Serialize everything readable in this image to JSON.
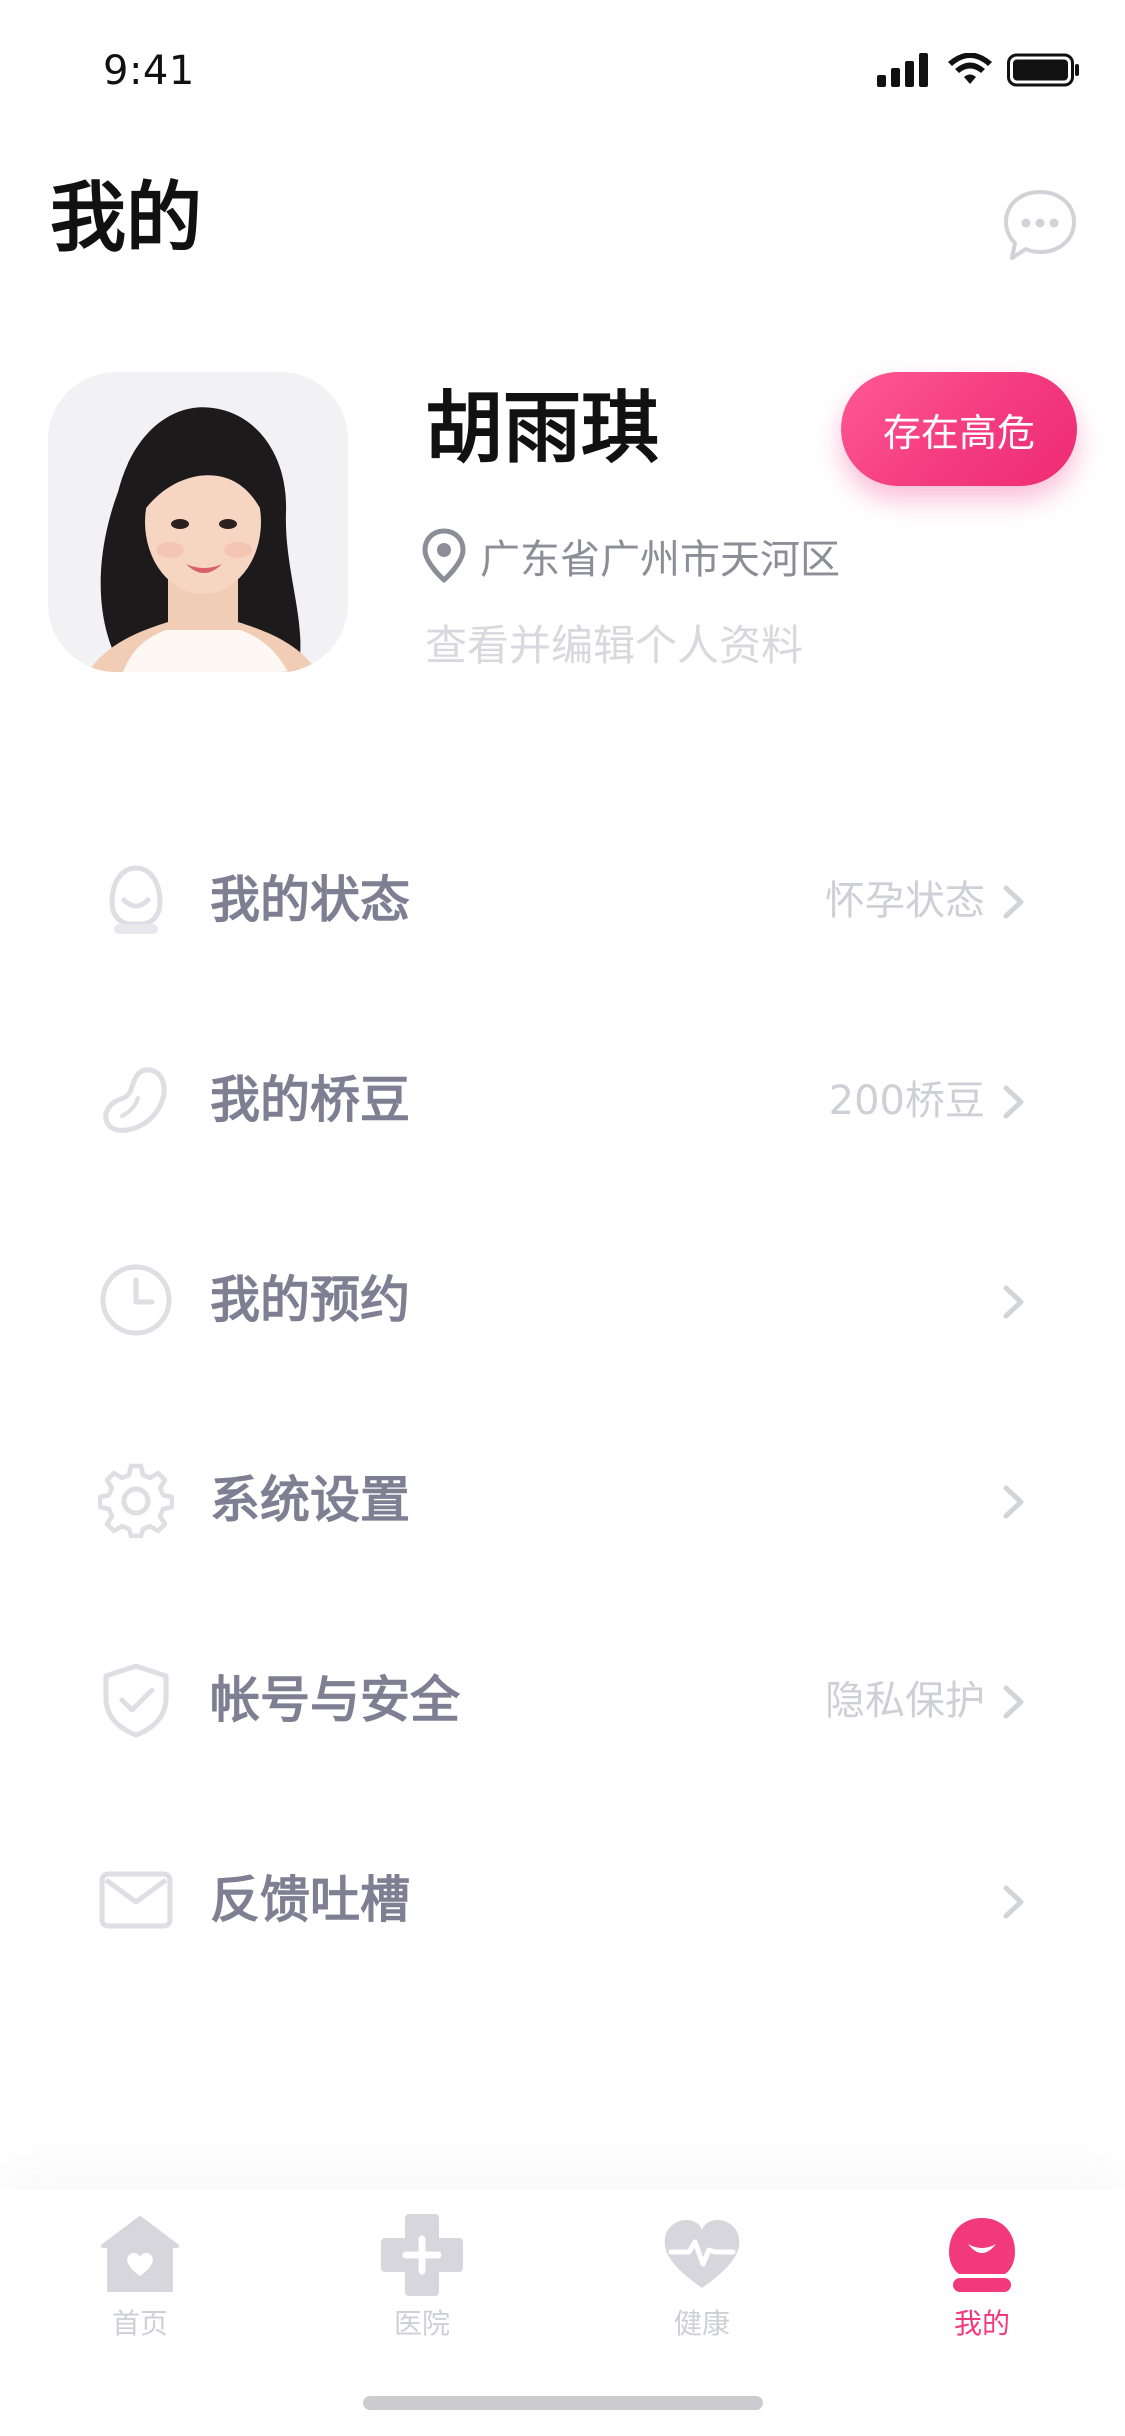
{
  "status_bar": {
    "time": "9:41"
  },
  "header": {
    "title": "我的",
    "message_icon": "chat-bubble-icon"
  },
  "profile": {
    "name": "胡雨琪",
    "risk_badge": "存在高危",
    "location": "广东省广州市天河区",
    "edit_link": "查看并编辑个人资料",
    "avatar_alt": "user avatar photo"
  },
  "menu": {
    "items": [
      {
        "label": "我的状态",
        "value": "怀孕状态",
        "icon": "face-status-icon"
      },
      {
        "label": "我的桥豆",
        "value": "200桥豆",
        "icon": "bean-icon"
      },
      {
        "label": "我的预约",
        "value": "",
        "icon": "clock-icon"
      },
      {
        "label": "系统设置",
        "value": "",
        "icon": "gear-icon"
      },
      {
        "label": "帐号与安全",
        "value": "隐私保护",
        "icon": "shield-check-icon"
      },
      {
        "label": "反馈吐槽",
        "value": "",
        "icon": "mail-icon"
      }
    ]
  },
  "tab_bar": {
    "tabs": [
      {
        "label": "首页",
        "icon": "home-icon"
      },
      {
        "label": "医院",
        "icon": "hospital-cross-icon"
      },
      {
        "label": "健康",
        "icon": "heart-pulse-icon"
      },
      {
        "label": "我的",
        "icon": "profile-icon"
      }
    ],
    "active": "我的"
  },
  "colors": {
    "accent": "#f1397b",
    "text_primary": "#111111",
    "text_secondary": "#8d8d98",
    "menu_text": "#7e7f92",
    "muted": "#cfcfd7"
  }
}
